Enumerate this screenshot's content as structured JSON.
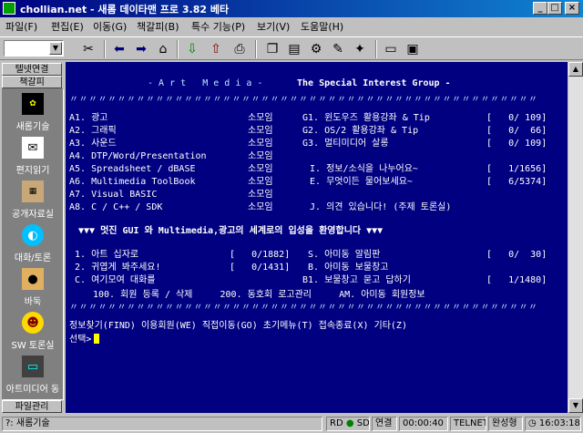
{
  "window": {
    "title": "chollian.net - 새롬 데이타맨 프로 3.82 베타",
    "minimize": "_",
    "maximize": "□",
    "close": "×"
  },
  "menu": [
    "파일(F)",
    "편집(E)",
    "이동(G)",
    "책갈피(B)",
    "특수 기능(P)",
    "보기(V)",
    "도움말(H)"
  ],
  "toolbar": {
    "combo_value": "",
    "icons": [
      "disconnect-icon",
      "back-arrow-icon",
      "forward-arrow-icon",
      "home-icon",
      "download-icon",
      "copy-icon",
      "paste-icon",
      "settings-icon",
      "edit-icon",
      "window-icon",
      "window2-icon"
    ]
  },
  "sidebar": {
    "top_buttons": [
      "텔넷연결",
      "책갈피"
    ],
    "items": [
      {
        "label": "새롬기술",
        "icon": "seorom-logo-icon"
      },
      {
        "label": "편지읽기",
        "icon": "mail-icon"
      },
      {
        "label": "공개자료실",
        "icon": "archive-icon"
      },
      {
        "label": "대화/토론",
        "icon": "chat-icon"
      },
      {
        "label": "바둑",
        "icon": "baduk-icon"
      },
      {
        "label": "SW 토론실",
        "icon": "sw-forum-icon"
      },
      {
        "label": "아트미디어 동",
        "icon": "monitor-icon"
      }
    ],
    "bottom_button": "파일관리"
  },
  "terminal": {
    "banner_title": "- A r t   M e d i a -",
    "banner_subtitle": "The Special Interest Group -",
    "rows_left": [
      {
        "code": "A1.",
        "name": "광고",
        "type": "소모임"
      },
      {
        "code": "A2.",
        "name": "그래픽",
        "type": "소모임"
      },
      {
        "code": "A3.",
        "name": "사운드",
        "type": "소모임"
      },
      {
        "code": "A4.",
        "name": "DTP/Word/Presentation",
        "type": "소모임"
      },
      {
        "code": "A5.",
        "name": "Spreadsheet / dBASE",
        "type": "소모임"
      },
      {
        "code": "A6.",
        "name": "Multimedia ToolBook",
        "type": "소모임"
      },
      {
        "code": "A7.",
        "name": "Visual BASIC",
        "type": "소모임"
      },
      {
        "code": "A8.",
        "name": "C / C++ / SDK",
        "type": "소모임"
      }
    ],
    "rows_right": [
      {
        "code": "G1.",
        "name": "윈도우즈 활용강좌 & Tip",
        "count": "[   0/ 109]"
      },
      {
        "code": "G2.",
        "name": "OS/2 활용강좌 & Tip",
        "count": "[   0/  66]"
      },
      {
        "code": "G3.",
        "name": "멀티미디어 살롱",
        "count": "[   0/ 109]"
      },
      {
        "code": "",
        "name": "",
        "count": ""
      },
      {
        "code": "I.",
        "name": "정보/소식을 나누어요~",
        "count": "[   1/1656]"
      },
      {
        "code": "E.",
        "name": "무엇이든 물어보세요~",
        "count": "[   6/5374]"
      },
      {
        "code": "",
        "name": "",
        "count": ""
      },
      {
        "code": "J.",
        "name": "의견 있습니다! (주제 토론실)",
        "count": ""
      }
    ],
    "welcome": "▼▼▼ 멋진 GUI 와 Multimedia,광고의 세계로의 입성을 환영합니다 ▼▼▼",
    "board_left": [
      {
        "code": "1.",
        "name": "아트 십자로",
        "count": "[   0/1882]"
      },
      {
        "code": "2.",
        "name": "귀엽게 봐주세요!",
        "count": "[   0/1431]"
      },
      {
        "code": "C.",
        "name": "여기모여 대화를",
        "count": ""
      }
    ],
    "board_right": [
      {
        "code": "S.",
        "name": "아미동 알림판",
        "count": "[   0/  30]"
      },
      {
        "code": "B.",
        "name": "아미동 보물창고",
        "count": ""
      },
      {
        "code": "B1.",
        "name": "보물창고 묻고 답하기",
        "count": "[   1/1480]"
      }
    ],
    "footer_line": "100. 회원 등록 / 삭제     200. 동호회 로고관리     AM. 아미동 회원정보",
    "command_line": "정보찾기(FIND) 이용회원(WE) 직접이동(GO) 초기메뉴(T) 접속종료(X) 기타(Z)",
    "prompt": "선택>"
  },
  "status": {
    "left_text": "새롬기술",
    "rd": "RD",
    "sd": "SD",
    "connection": "연결",
    "time": "00:00:40",
    "protocol": "TELNET",
    "mode": "완성형",
    "clock": "16:03:18"
  }
}
